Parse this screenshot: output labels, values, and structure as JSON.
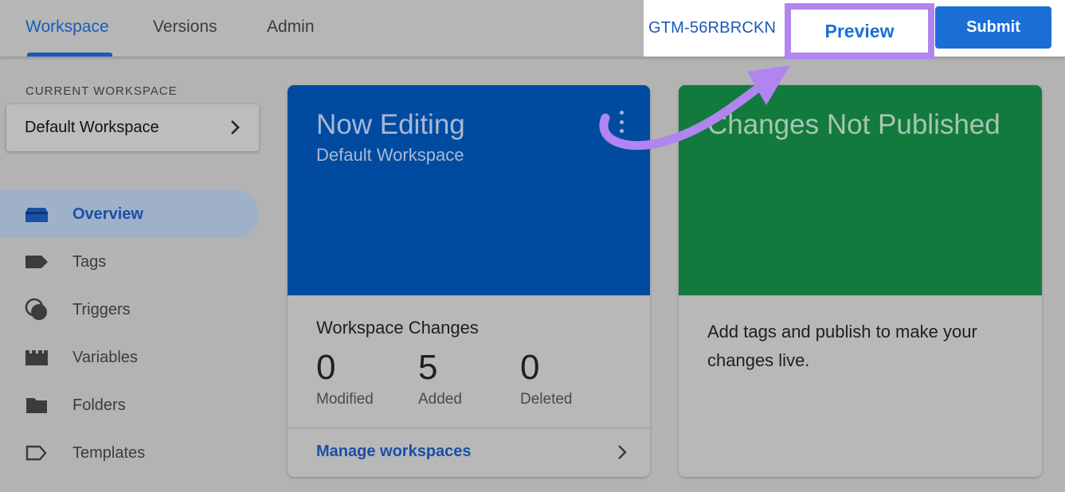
{
  "topbar": {
    "tabs": [
      {
        "label": "Workspace",
        "active": true
      },
      {
        "label": "Versions",
        "active": false
      },
      {
        "label": "Admin",
        "active": false
      }
    ],
    "container_id": "GTM-56RBRCKN",
    "preview_label": "Preview",
    "submit_label": "Submit"
  },
  "sidebar": {
    "current_workspace_label": "CURRENT WORKSPACE",
    "workspace_name": "Default Workspace",
    "items": [
      {
        "label": "Overview",
        "icon": "overview-icon",
        "active": true
      },
      {
        "label": "Tags",
        "icon": "tag-icon",
        "active": false
      },
      {
        "label": "Triggers",
        "icon": "trigger-icon",
        "active": false
      },
      {
        "label": "Variables",
        "icon": "variables-icon",
        "active": false
      },
      {
        "label": "Folders",
        "icon": "folder-icon",
        "active": false
      },
      {
        "label": "Templates",
        "icon": "template-icon",
        "active": false
      }
    ]
  },
  "editing_card": {
    "title": "Now Editing",
    "subtitle": "Default Workspace",
    "changes_title": "Workspace Changes",
    "stats": [
      {
        "value": "0",
        "label": "Modified"
      },
      {
        "value": "5",
        "label": "Added"
      },
      {
        "value": "0",
        "label": "Deleted"
      }
    ],
    "manage_link": "Manage workspaces"
  },
  "publish_card": {
    "title": "Changes Not Published",
    "text": "Add tags and publish to make your changes live."
  },
  "colors": {
    "accent_blue": "#1a6fd6",
    "editing_card": "#004ba0",
    "publish_card": "#127a3d",
    "annotation": "#b284f0"
  }
}
